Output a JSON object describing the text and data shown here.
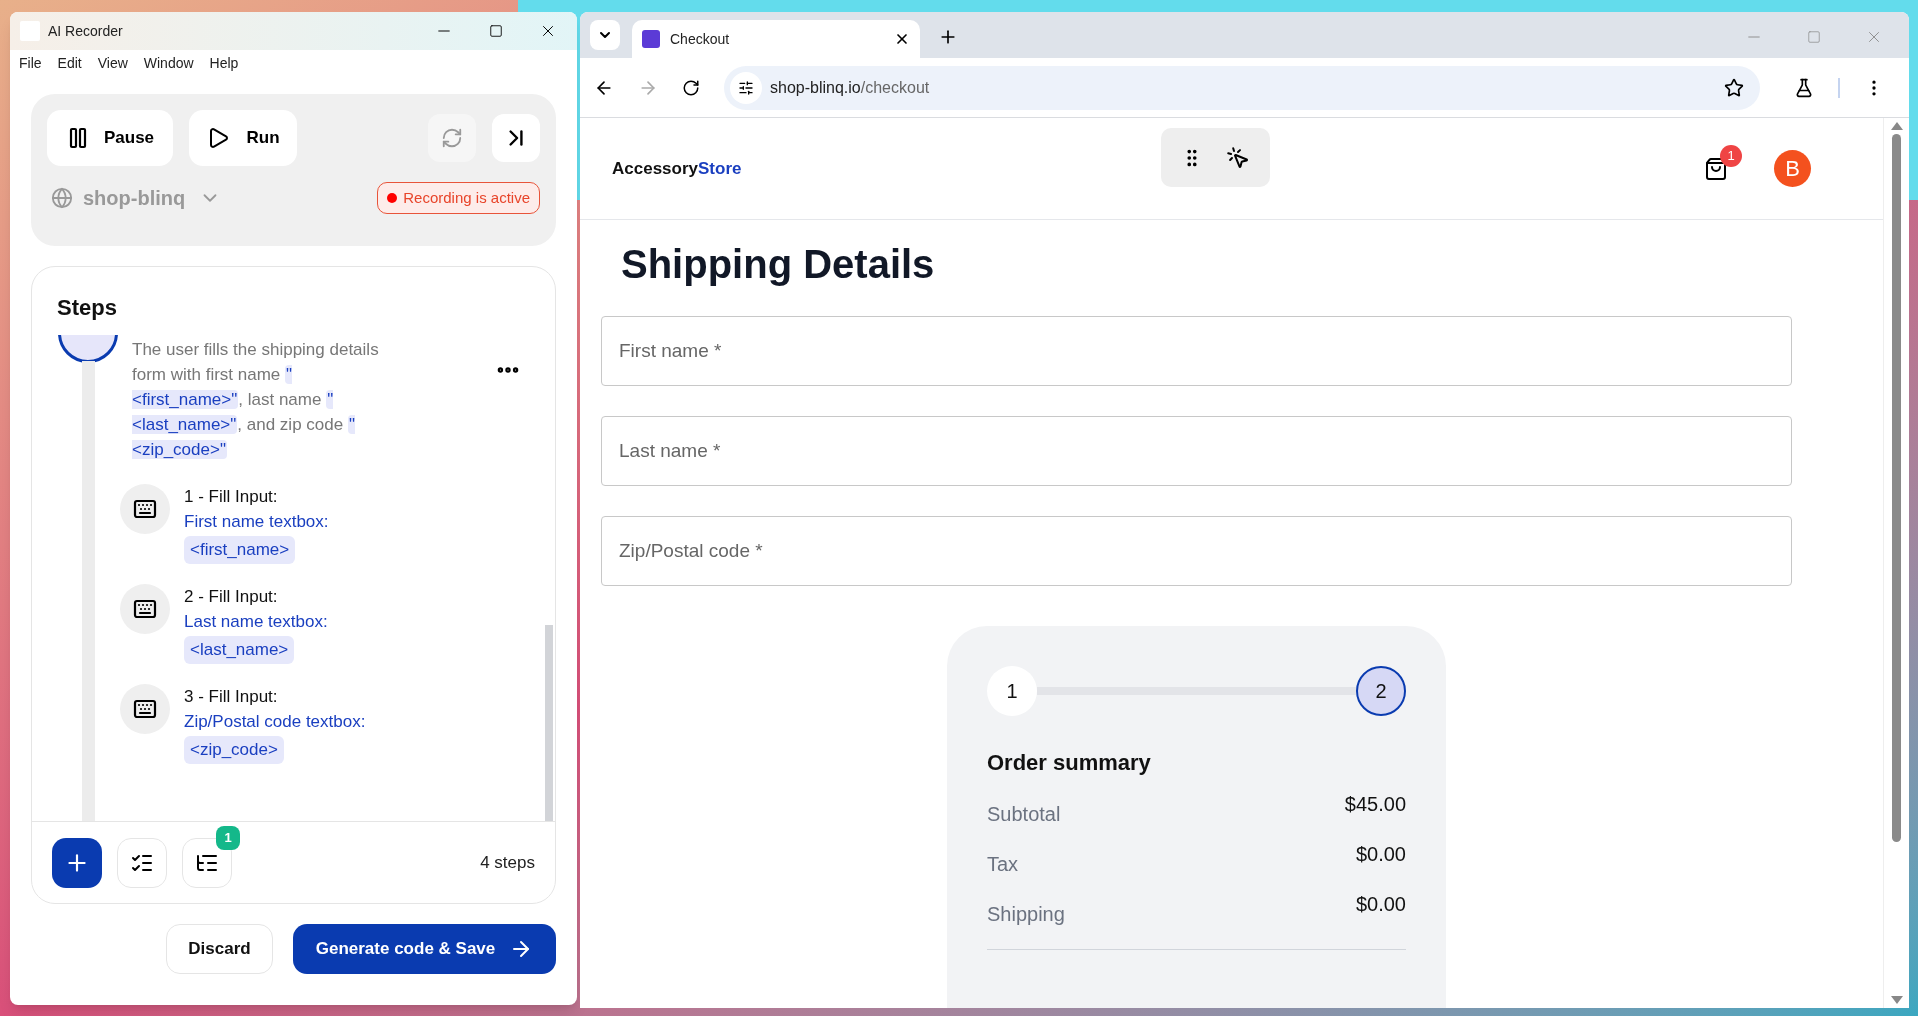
{
  "recorder": {
    "title": "AI Recorder",
    "menu": [
      "File",
      "Edit",
      "View",
      "Window",
      "Help"
    ],
    "controls": {
      "pause": "Pause",
      "run": "Run"
    },
    "site": "shop-blinq",
    "recording": {
      "active": true,
      "label": "Recording is active"
    },
    "steps": {
      "title": "Steps",
      "description": [
        {
          "kind": "text",
          "text": "The user fills the shipping details form with first name "
        },
        {
          "kind": "chip",
          "text": "\"<first_name>\""
        },
        {
          "kind": "text",
          "text": ", last name "
        },
        {
          "kind": "chip",
          "text": "\"<last_name>\""
        },
        {
          "kind": "text",
          "text": ", and zip code "
        },
        {
          "kind": "chip",
          "text": "\"<zip_code>\""
        }
      ],
      "actions": [
        {
          "label": "1 - Fill Input:",
          "target": "First name textbox:",
          "value": "<first_name>"
        },
        {
          "label": "2 - Fill Input:",
          "target": "Last name textbox:",
          "value": "<last_name>"
        },
        {
          "label": "3 - Fill Input:",
          "target": "Zip/Postal code textbox:",
          "value": "<zip_code>"
        }
      ],
      "badge": "1",
      "count": "4 steps"
    },
    "buttons": {
      "discard": "Discard",
      "generate": "Generate code & Save"
    }
  },
  "browser": {
    "tabs": [
      {
        "title": "Checkout",
        "selected": true
      }
    ],
    "url": {
      "host": "shop-blinq.io",
      "path": "/checkout"
    },
    "page": {
      "logo": {
        "first": "Accessory",
        "second": "Store"
      },
      "cart_badge": "1",
      "avatar": "B",
      "heading": "Shipping Details",
      "fields": [
        {
          "placeholder": "First name *"
        },
        {
          "placeholder": "Last name *"
        },
        {
          "placeholder": "Zip/Postal code *"
        }
      ],
      "progress": [
        {
          "label": "1",
          "selected": false
        },
        {
          "label": "2",
          "selected": true
        }
      ],
      "summary": {
        "title": "Order summary",
        "rows": [
          {
            "label": "Subtotal",
            "value": "$45.00"
          },
          {
            "label": "Tax",
            "value": "$0.00"
          },
          {
            "label": "Shipping",
            "value": "$0.00"
          }
        ]
      }
    }
  }
}
